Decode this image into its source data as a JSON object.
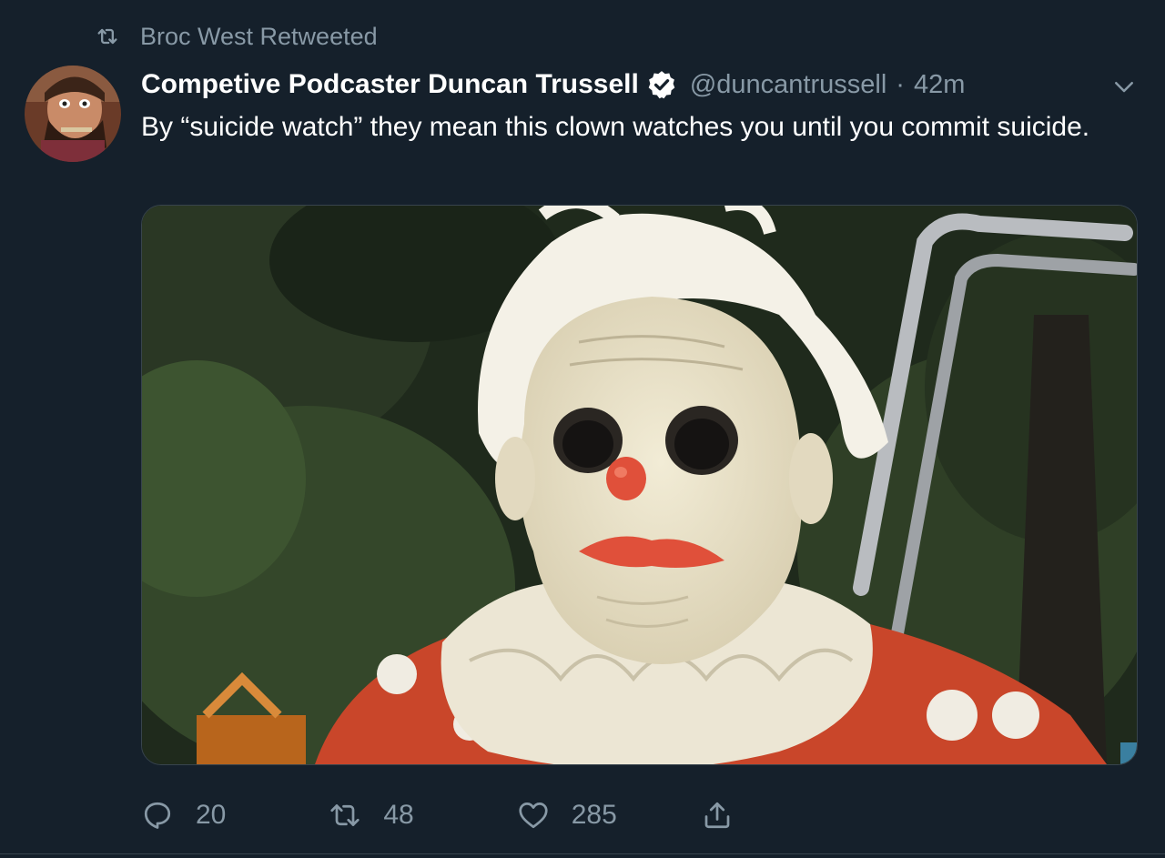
{
  "retweet_context": {
    "label": "Broc West Retweeted",
    "icon": "retweet-icon"
  },
  "tweet": {
    "display_name": "Competive Podcaster Duncan Trussell",
    "verified": true,
    "handle": "@duncantrussell",
    "separator": "·",
    "time": "42m",
    "text": "By “suicide watch” they mean this clown watches you until you commit suicide.",
    "media": {
      "kind": "photo",
      "subject": "clown-mask-photo"
    }
  },
  "actions": {
    "reply": {
      "icon": "reply-icon",
      "count": "20"
    },
    "retweet": {
      "icon": "retweet-icon",
      "count": "48"
    },
    "like": {
      "icon": "heart-icon",
      "count": "285"
    },
    "share": {
      "icon": "share-icon"
    }
  },
  "menu": {
    "icon": "chevron-down-icon"
  },
  "colors": {
    "background": "#15202b",
    "secondary_text": "#8899a6",
    "primary_text": "#ffffff",
    "border": "#38444d"
  }
}
